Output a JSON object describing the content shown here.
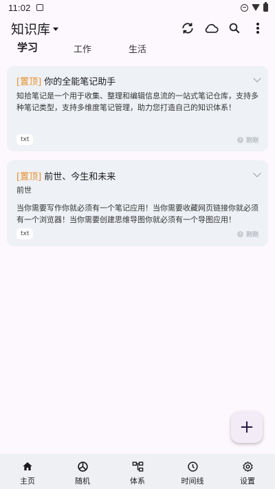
{
  "status_bar": {
    "time": "11:02"
  },
  "app_bar": {
    "title": "知识库",
    "actions": [
      "sync-icon",
      "cloud-icon",
      "search-icon",
      "more-vert-icon"
    ]
  },
  "tabs": [
    {
      "label": "学习",
      "active": true
    },
    {
      "label": "工作",
      "active": false
    },
    {
      "label": "生活",
      "active": false
    }
  ],
  "notes": [
    {
      "pin": "[置顶]",
      "title": "你的全能笔记助手",
      "body": "知拾笔记是一个用于收集、整理和编辑信息流的一站式笔记仓库，支持多种笔记类型，支持多维度笔记管理，助力您打造自己的知识体系！",
      "tag": "txt",
      "time": "刚刚"
    },
    {
      "pin": "[置顶]",
      "title": "前世、今生和未来",
      "subtitle": "前世",
      "body": "当你需要写作你就必须有一个笔记应用！当你需要收藏网页链接你就必须有一个浏览器！当你需要创建思维导图你就必须有一个导图应用！",
      "tag": "txt",
      "time": "刚刚"
    }
  ],
  "fab": {
    "label": "+"
  },
  "bottom_nav": [
    {
      "label": "主页",
      "icon": "home-icon"
    },
    {
      "label": "随机",
      "icon": "random-icon"
    },
    {
      "label": "体系",
      "icon": "hierarchy-icon"
    },
    {
      "label": "时间线",
      "icon": "timeline-icon"
    },
    {
      "label": "设置",
      "icon": "settings-icon"
    }
  ],
  "colors": {
    "pin": "#e8902f",
    "card_bg": "#eef1f5",
    "background": "#fdf8fd"
  }
}
